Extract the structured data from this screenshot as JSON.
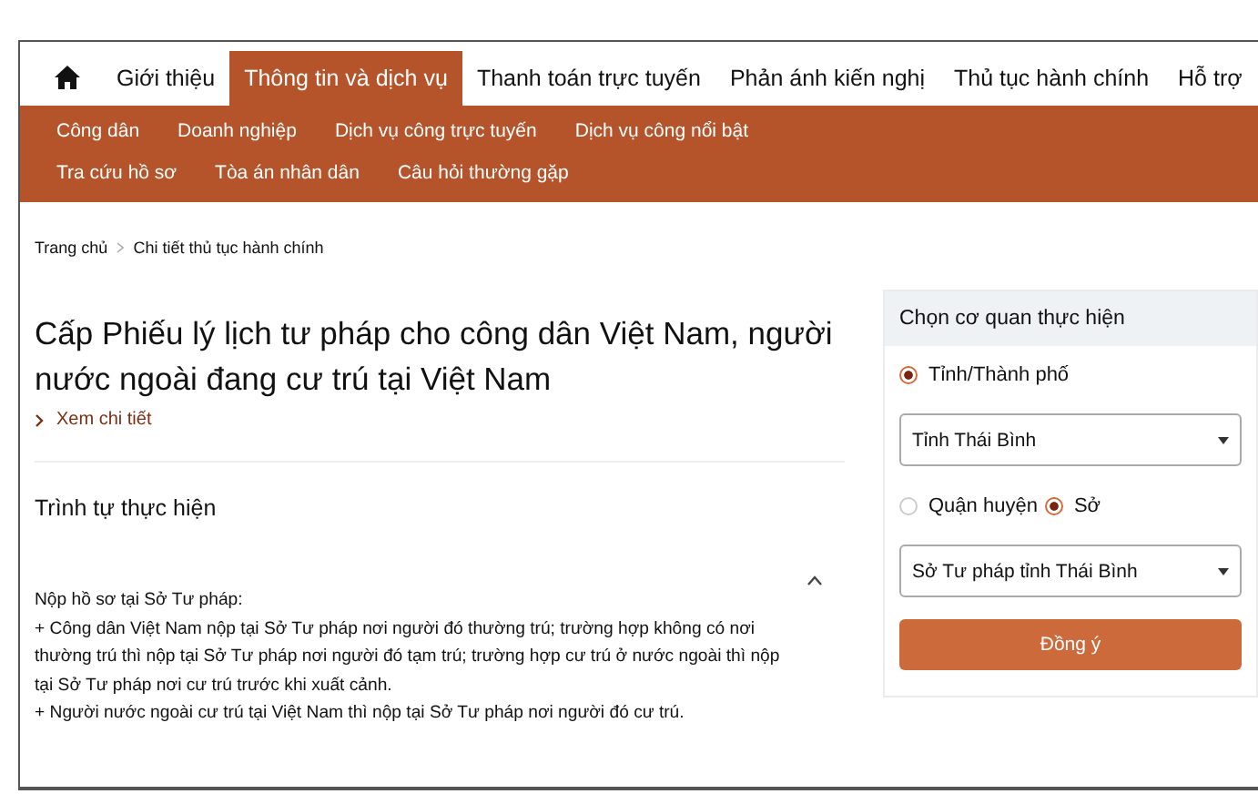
{
  "main_nav": [
    {
      "label": "Giới thiệu",
      "selected": false
    },
    {
      "label": "Thông tin và dịch vụ",
      "selected": true
    },
    {
      "label": "Thanh toán trực tuyến",
      "selected": false
    },
    {
      "label": "Phản ánh kiến nghị",
      "selected": false
    },
    {
      "label": "Thủ tục hành chính",
      "selected": false
    },
    {
      "label": "Hỗ trợ",
      "selected": false
    }
  ],
  "sub_nav": [
    "Công dân",
    "Doanh nghiệp",
    "Dịch vụ công trực tuyến",
    "Dịch vụ công nổi bật",
    "Tra cứu hồ sơ",
    "Tòa án nhân dân",
    "Câu hỏi thường gặp"
  ],
  "breadcrumb": [
    "Trang chủ",
    "Chi tiết thủ tục hành chính"
  ],
  "title": "Cấp Phiếu lý lịch tư pháp cho công dân Việt Nam, người nước ngoài đang cư trú tại Việt Nam",
  "details_link": "Xem chi tiết",
  "section": {
    "title": "Trình tự thực hiện",
    "expanded": true,
    "lines": [
      "Nộp hồ sơ tại Sở Tư pháp:",
      "+ Công dân Việt Nam nộp tại Sở Tư pháp nơi người đó thường trú; trường hợp không có nơi",
      "thường trú thì nộp tại Sở Tư pháp nơi người đó tạm trú; trường hợp cư trú ở nước ngoài thì nộp",
      "tại Sở Tư pháp nơi cư trú trước khi xuất cảnh.",
      "+ Người nước ngoài cư trú tại Việt Nam thì nộp tại Sở Tư pháp nơi người đó cư trú."
    ]
  },
  "agency_panel": {
    "title": "Chọn cơ quan thực hiện",
    "level_options": [
      {
        "label": "Tỉnh/Thành phố",
        "selected": true
      }
    ],
    "province_select": {
      "value": "Tỉnh Thái Bình"
    },
    "unit_options": [
      {
        "label": "Quận huyện",
        "selected": false
      },
      {
        "label": "Sở",
        "selected": true
      }
    ],
    "department_select": {
      "value": "Sở Tư pháp tỉnh Thái Bình"
    },
    "submit_button": "Đồng ý"
  }
}
